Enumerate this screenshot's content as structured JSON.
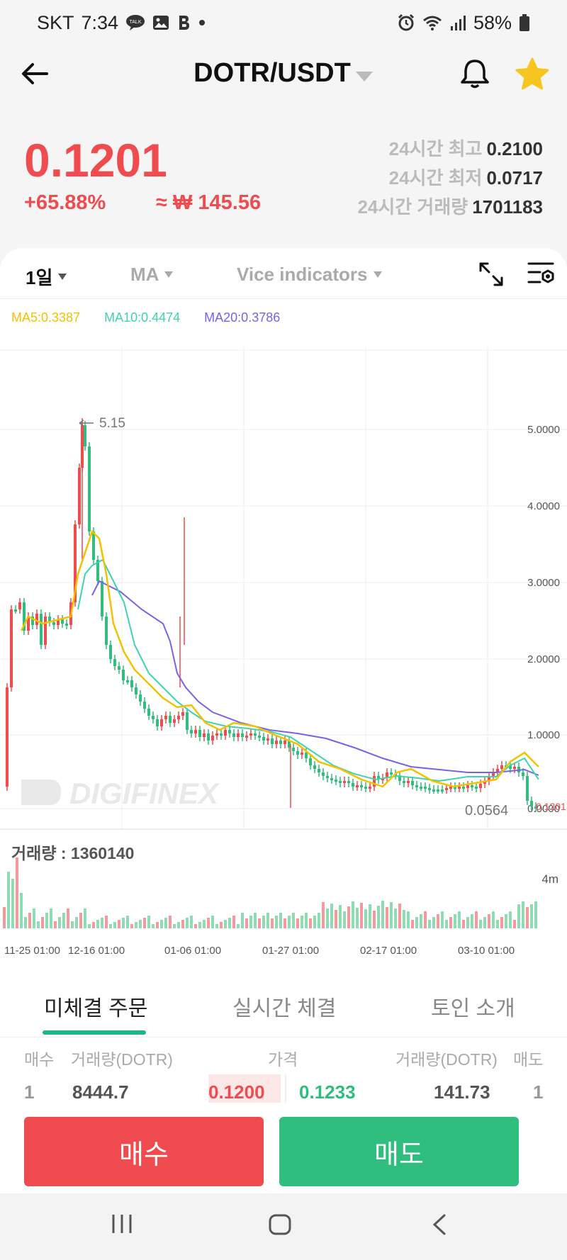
{
  "status": {
    "carrier": "SKT",
    "time": "7:34",
    "battery": "58%",
    "icons_left": [
      "talk-icon",
      "image-icon",
      "b-icon",
      "dot-icon"
    ],
    "icons_right": [
      "alarm-icon",
      "wifi-icon",
      "signal-icon",
      "battery-icon"
    ]
  },
  "header": {
    "pair": "DOTR/USDT"
  },
  "ticker": {
    "price": "0.1201",
    "change": "+65.88%",
    "krw": "≈ ₩ 145.56",
    "high_label": "24시간 최고",
    "high_value": "0.2100",
    "low_label": "24시간 최저",
    "low_value": "0.0717",
    "vol_label": "24시간 거래량",
    "vol_value": "1701183"
  },
  "toolbar": {
    "interval": "1일",
    "ma": "MA",
    "vice": "Vice indicators"
  },
  "ma_legend": {
    "ma5": "MA5:0.3387",
    "ma10": "MA10:0.4474",
    "ma20": "MA20:0.3786"
  },
  "colors": {
    "up": "#f04c4f",
    "down": "#2fbe7d",
    "ma5": "#f2c200",
    "ma10": "#3fd3b0",
    "ma20": "#7b61e8"
  },
  "chart_data": {
    "type": "candlestick",
    "y_ticks": [
      "5.0000",
      "4.0000",
      "3.0000",
      "2.0000",
      "1.0000",
      "0.0000"
    ],
    "ylim": [
      0,
      5.4
    ],
    "max_label": "5.15",
    "min_label": "0.0564",
    "last_label": "0.1201",
    "watermark": "DIGIFINEX",
    "volume_label": "거래량 : 1360140",
    "volume_axis_label": "4m",
    "x_ticks": [
      "11-25 01:00",
      "12-16 01:00",
      "01-06 01:00",
      "01-27 01:00",
      "02-17 01:00",
      "03-10 01:00"
    ]
  },
  "tabs": {
    "open_orders": "미체결 주문",
    "live_trades": "실시간 체결",
    "token_info": "토인 소개"
  },
  "orderbook": {
    "h_buy": "매수",
    "h_buy_vol": "거래량(DOTR)",
    "h_price": "가격",
    "h_sell_vol": "거래량(DOTR)",
    "h_sell": "매도",
    "buy_idx": "1",
    "buy_vol": "8444.7",
    "buy_price": "0.1200",
    "sell_price": "0.1233",
    "sell_vol": "141.73",
    "sell_idx": "1"
  },
  "actions": {
    "buy": "매수",
    "sell": "매도"
  }
}
